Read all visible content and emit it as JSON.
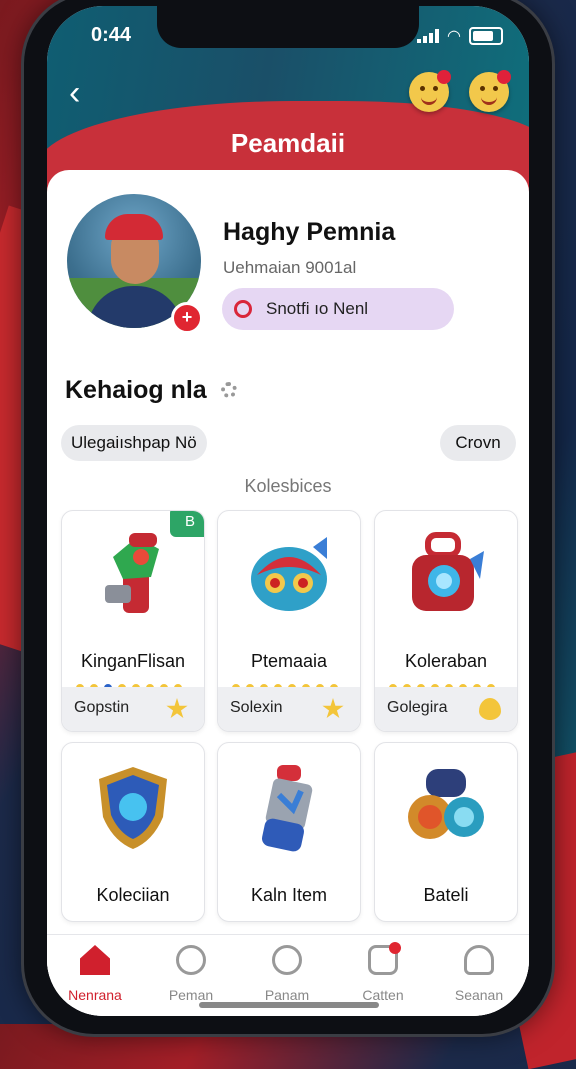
{
  "status": {
    "time": "0:44"
  },
  "header": {
    "title": "Peamdaii"
  },
  "profile": {
    "name": "Haghy Pemnia",
    "subtitle": "Uehmaian 9001al",
    "badge_label": "Snotfi ıo Nenl"
  },
  "section": {
    "title": "Kehaiog nla",
    "filter_left": "Ulegaiıshpap Nö",
    "filter_right": "Crovn",
    "collection_label": "Kolesbices"
  },
  "items": [
    {
      "label": "KinganFlisan",
      "footer": "Gopstin",
      "badge": "B"
    },
    {
      "label": "Ptemaaia",
      "footer": "Solexin"
    },
    {
      "label": "Koleraban",
      "footer": "Golegira"
    },
    {
      "label": "Koleciian"
    },
    {
      "label": "Kaln Item"
    },
    {
      "label": "Bateli"
    }
  ],
  "tabs": [
    {
      "label": "Nenrana"
    },
    {
      "label": "Peman"
    },
    {
      "label": "Panam"
    },
    {
      "label": "Catten"
    },
    {
      "label": "Seanan"
    }
  ],
  "colors": {
    "accent": "#d0202d",
    "header": "#0f5e72",
    "pill": "#e6d7f3",
    "star": "#f3c53a"
  }
}
